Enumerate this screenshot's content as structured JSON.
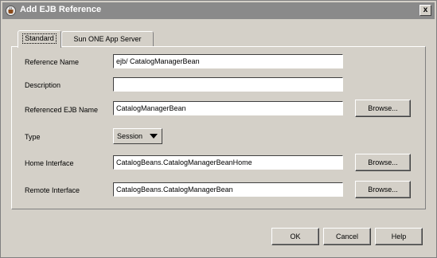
{
  "window": {
    "title": "Add EJB Reference",
    "close_label": "x"
  },
  "tabs": [
    {
      "label": "Standard",
      "active": true
    },
    {
      "label": "Sun ONE App Server",
      "active": false
    }
  ],
  "form": {
    "reference_name": {
      "label": "Reference Name",
      "value": "ejb/ CatalogManagerBean"
    },
    "description": {
      "label": "Description",
      "value": ""
    },
    "referenced_ejb_name": {
      "label": "Referenced EJB Name",
      "value": "CatalogManagerBean",
      "browse_label": "Browse..."
    },
    "type": {
      "label": "Type",
      "value": "Session"
    },
    "home_interface": {
      "label": "Home Interface",
      "value": "CatalogBeans.CatalogManagerBeanHome",
      "browse_label": "Browse..."
    },
    "remote_interface": {
      "label": "Remote Interface",
      "value": "CatalogBeans.CatalogManagerBean",
      "browse_label": "Browse..."
    }
  },
  "buttons": {
    "ok": "OK",
    "cancel": "Cancel",
    "help": "Help"
  }
}
